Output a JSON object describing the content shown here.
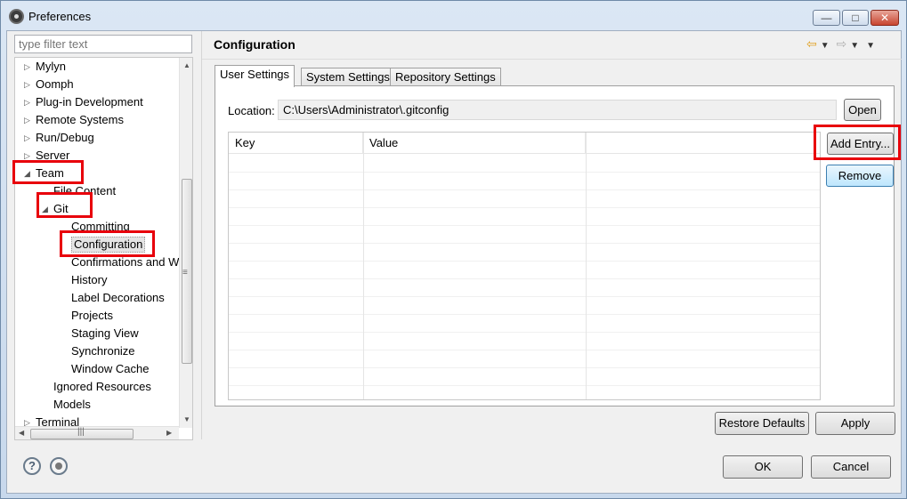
{
  "window": {
    "title": "Preferences"
  },
  "filter": {
    "placeholder": "type filter text"
  },
  "tree": [
    {
      "label": "Mylyn",
      "arrow": "▷",
      "level": 0
    },
    {
      "label": "Oomph",
      "arrow": "▷",
      "level": 0
    },
    {
      "label": "Plug-in Development",
      "arrow": "▷",
      "level": 0
    },
    {
      "label": "Remote Systems",
      "arrow": "▷",
      "level": 0
    },
    {
      "label": "Run/Debug",
      "arrow": "▷",
      "level": 0
    },
    {
      "label": "Server",
      "arrow": "▷",
      "level": 0
    },
    {
      "label": "Team",
      "arrow": "◢",
      "level": 0
    },
    {
      "label": "File Content",
      "arrow": "",
      "level": 1
    },
    {
      "label": "Git",
      "arrow": "◢",
      "level": 1
    },
    {
      "label": "Committing",
      "arrow": "",
      "level": 2
    },
    {
      "label": "Configuration",
      "arrow": "",
      "level": 2,
      "selected": true
    },
    {
      "label": "Confirmations and W",
      "arrow": "",
      "level": 2
    },
    {
      "label": "History",
      "arrow": "",
      "level": 2
    },
    {
      "label": "Label Decorations",
      "arrow": "",
      "level": 2
    },
    {
      "label": "Projects",
      "arrow": "",
      "level": 2
    },
    {
      "label": "Staging View",
      "arrow": "",
      "level": 2
    },
    {
      "label": "Synchronize",
      "arrow": "",
      "level": 2
    },
    {
      "label": "Window Cache",
      "arrow": "",
      "level": 2
    },
    {
      "label": "Ignored Resources",
      "arrow": "",
      "level": 1
    },
    {
      "label": "Models",
      "arrow": "",
      "level": 1
    },
    {
      "label": "Terminal",
      "arrow": "▷",
      "level": 0
    }
  ],
  "page": {
    "title": "Configuration"
  },
  "tabs": [
    {
      "label": "User Settings",
      "active": true
    },
    {
      "label": "System Settings",
      "active": false
    },
    {
      "label": "Repository Settings",
      "active": false
    }
  ],
  "location": {
    "label": "Location:",
    "value": "C:\\Users\\Administrator\\.gitconfig",
    "open_label": "Open"
  },
  "grid": {
    "columns": [
      "Key",
      "Value",
      ""
    ]
  },
  "buttons": {
    "add_entry": "Add Entry...",
    "remove": "Remove",
    "restore_defaults": "Restore Defaults",
    "apply": "Apply",
    "ok": "OK",
    "cancel": "Cancel"
  },
  "icons": {
    "help": "?",
    "back": "⇦",
    "forward": "⇨",
    "dropdown": "▼"
  },
  "colors": {
    "highlight": "#e8000b",
    "selection_bg": "#e4e4e4",
    "focus_border": "#3c7fb1"
  }
}
